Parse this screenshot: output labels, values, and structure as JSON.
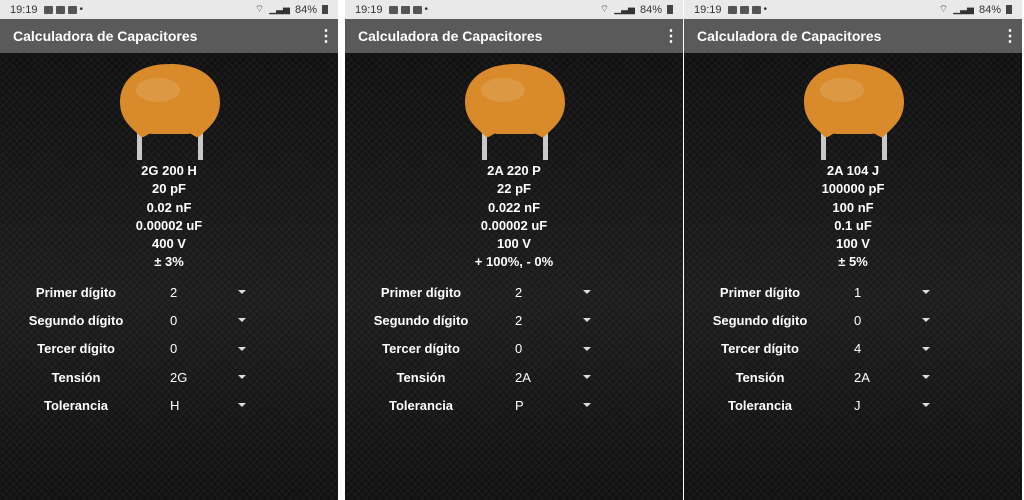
{
  "screens": [
    {
      "status": {
        "time": "19:19",
        "battery": "84%"
      },
      "app_title": "Calculadora de Capacitores",
      "code": "2G 200 H",
      "values": [
        "20 pF",
        "0.02 nF",
        "0.00002 uF",
        "400 V",
        "± 3%"
      ],
      "fields": [
        {
          "label": "Primer dígito",
          "value": "2"
        },
        {
          "label": "Segundo dígito",
          "value": "0"
        },
        {
          "label": "Tercer dígito",
          "value": "0"
        },
        {
          "label": "Tensión",
          "value": "2G"
        },
        {
          "label": "Tolerancia",
          "value": "H"
        }
      ]
    },
    {
      "status": {
        "time": "19:19",
        "battery": "84%"
      },
      "app_title": "Calculadora de Capacitores",
      "code": "2A 220 P",
      "values": [
        "22 pF",
        "0.022 nF",
        "0.00002 uF",
        "100 V",
        "+ 100%, - 0%"
      ],
      "fields": [
        {
          "label": "Primer dígito",
          "value": "2"
        },
        {
          "label": "Segundo dígito",
          "value": "2"
        },
        {
          "label": "Tercer dígito",
          "value": "0"
        },
        {
          "label": "Tensión",
          "value": "2A"
        },
        {
          "label": "Tolerancia",
          "value": "P"
        }
      ]
    },
    {
      "status": {
        "time": "19:19",
        "battery": "84%"
      },
      "app_title": "Calculadora de Capacitores",
      "code": "2A 104 J",
      "values": [
        "100000 pF",
        "100 nF",
        "0.1 uF",
        "100 V",
        "± 5%"
      ],
      "fields": [
        {
          "label": "Primer dígito",
          "value": "1"
        },
        {
          "label": "Segundo dígito",
          "value": "0"
        },
        {
          "label": "Tercer dígito",
          "value": "4"
        },
        {
          "label": "Tensión",
          "value": "2A"
        },
        {
          "label": "Tolerancia",
          "value": "J"
        }
      ]
    }
  ],
  "colors": {
    "capacitor_body": "#d98a2b",
    "capacitor_leg": "#c9c9c9",
    "appbar": "#5a5a5a",
    "statusbar": "#e9e9e9"
  },
  "icons": [
    "image-icon",
    "youtube-icon",
    "facebook-icon",
    "wifi-icon",
    "signal-icon",
    "battery-icon",
    "overflow-menu-icon",
    "dropdown-arrow-icon"
  ]
}
